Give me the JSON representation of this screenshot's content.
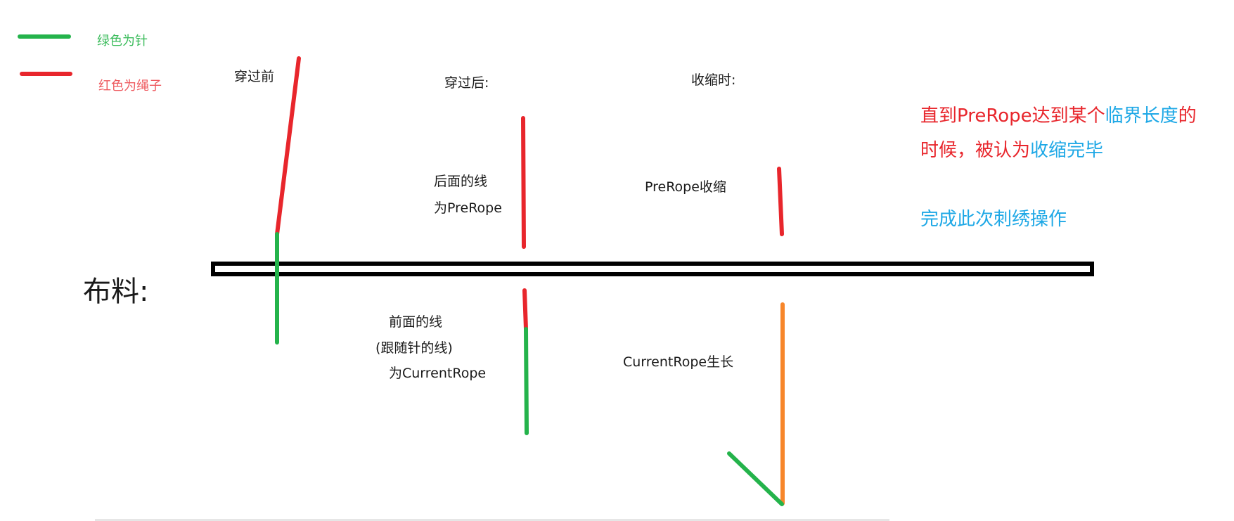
{
  "legend": {
    "needle": {
      "label": "绿色为针",
      "color": "#24b34b"
    },
    "rope": {
      "label": "红色为绳子",
      "color": "#e8262c"
    }
  },
  "labels": {
    "fabric": "布料:",
    "stage_before": "穿过前",
    "stage_after": "穿过后:",
    "stage_shrink": "收缩时:",
    "back_line_1": "后面的线",
    "back_line_2": "为PreRope",
    "front_line_1": "前面的线",
    "front_line_2": "(跟随针的线)",
    "front_line_3": "为CurrentRope",
    "prerope_shrink": "PreRope收缩",
    "currentrope_grow": "CurrentRope生长"
  },
  "note": {
    "line1_red_a": "直到PreRope达到某个",
    "line1_blue": "临界长度",
    "line1_red_b": "的",
    "line2_red": "时候，被认为",
    "line2_blue": "收缩完毕",
    "line3_blue": "完成此次刺绣操作"
  },
  "colors": {
    "needle": "#24b34b",
    "rope": "#e8262c",
    "growing_rope": "#f7862a",
    "fabric": "#000000",
    "accent_blue": "#1ea8e6"
  }
}
